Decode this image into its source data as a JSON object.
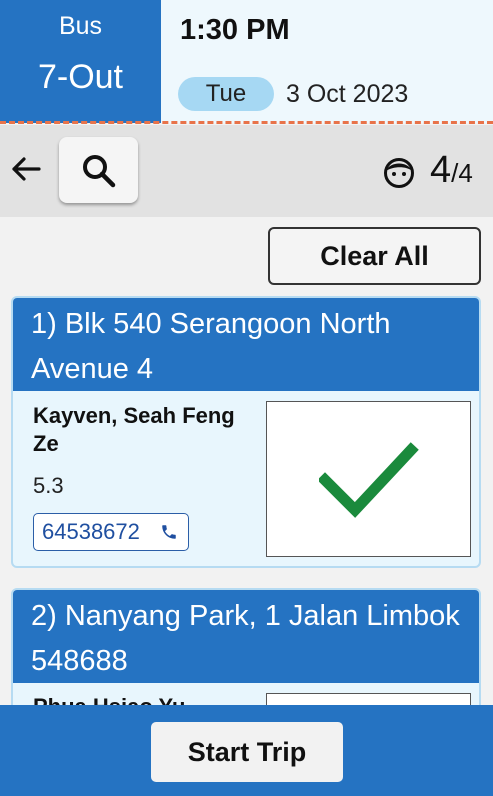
{
  "header": {
    "bus_label": "Bus",
    "route": "7-Out",
    "time": "1:30 PM",
    "day": "Tue",
    "date": "3 Oct 2023"
  },
  "toolbar": {
    "back_icon": "arrow-left-icon",
    "search_icon": "search-icon",
    "passenger_icon": "face-icon",
    "count_current": "4",
    "count_total": "/4"
  },
  "clear_all_label": "Clear All",
  "stops": [
    {
      "title": "1) Blk 540 Serangoon North Avenue 4",
      "name": "Kayven, Seah Feng Ze",
      "distance": "5.3",
      "phone": "64538672",
      "status_icon": "check-icon"
    },
    {
      "title": "2) Nanyang Park, 1 Jalan Limbok 548688",
      "name": "Phua Hsiao Yu"
    }
  ],
  "start_trip_label": "Start Trip",
  "colors": {
    "primary": "#2573c2",
    "pill": "#a6d8f3",
    "dashed_line": "#e8734a",
    "check": "#1a8a3c"
  }
}
